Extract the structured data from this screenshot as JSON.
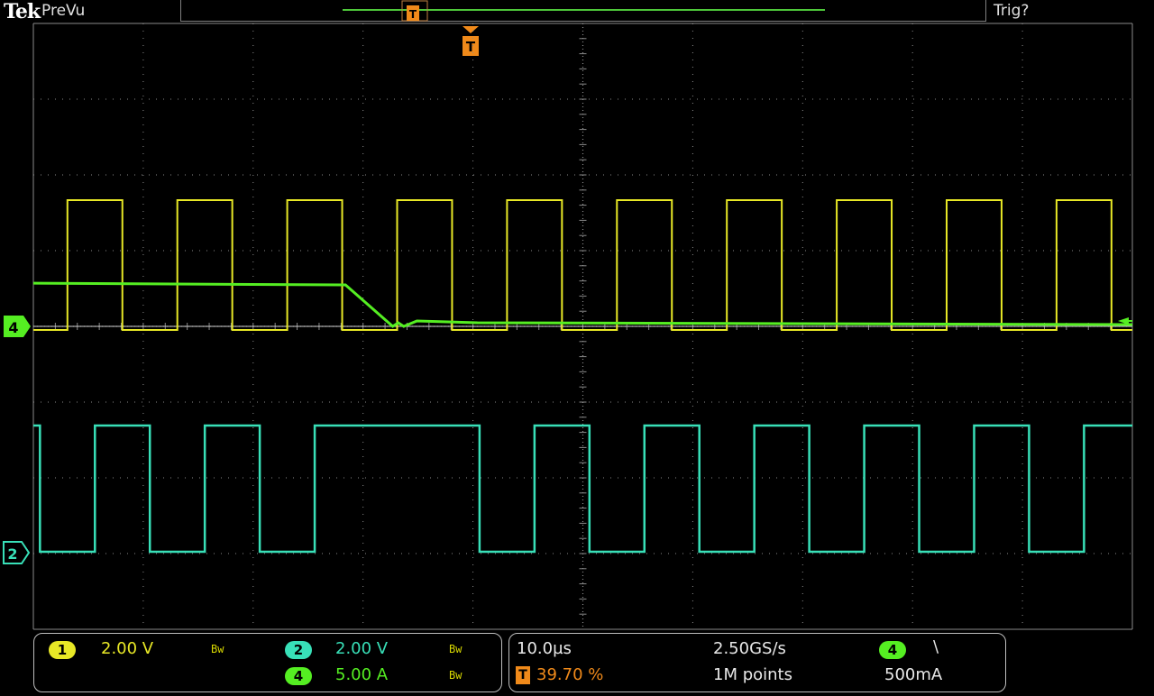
{
  "header": {
    "brand": "Tek",
    "mode": "PreVu",
    "trigger_status": "Trig?"
  },
  "colors": {
    "ch1": "#e8e826",
    "ch2": "#38e0b8",
    "ch4": "#55ee22",
    "trigger": "#f08a1a",
    "grid": "#8a8a8a"
  },
  "markers": {
    "ch4": "4",
    "ch2": "2",
    "trigger": "T"
  },
  "channels": {
    "ch1": {
      "badge": "1",
      "scale": "2.00 V",
      "bw": "Bw"
    },
    "ch2": {
      "badge": "2",
      "scale": "2.00 V",
      "bw": "Bw"
    },
    "ch4": {
      "badge": "4",
      "scale": "5.00 A",
      "bw": "Bw"
    }
  },
  "timebase": {
    "scale": "10.0µs",
    "sample_rate": "2.50GS/s",
    "trigger_position": "39.70 %",
    "record_length": "1M points"
  },
  "trigger": {
    "source_badge": "4",
    "slope": "\\",
    "level": "500mA"
  },
  "chart_data": {
    "type": "line",
    "x_unit": "µs",
    "x_range": [
      -39.7,
      60.3
    ],
    "series": [
      {
        "channel": "1",
        "volts_per_div": 2.0,
        "description_levels_div": {
          "high": 1.0,
          "low": 0.0
        },
        "period_us": 10.0,
        "duty": 0.5
      },
      {
        "channel": "2",
        "volts_per_div": 2.0,
        "period_us": 10.0,
        "duty": 0.5
      },
      {
        "channel": "4",
        "amps_per_div": 5.0,
        "initial_A": 2.85,
        "final_A": 0.0
      }
    ]
  }
}
